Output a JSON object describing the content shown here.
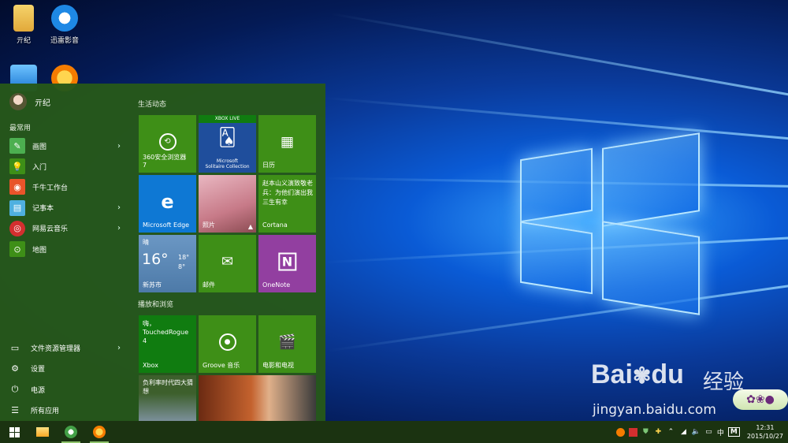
{
  "desktop": {
    "icons": [
      {
        "label": "亓纪",
        "icon": "user-folder-icon"
      },
      {
        "label": "迅雷影音",
        "icon": "xunlei-player-icon"
      },
      {
        "label": "",
        "icon": "this-pc-icon"
      },
      {
        "label": "",
        "icon": "qianniu-icon"
      }
    ]
  },
  "start_menu": {
    "user_name": "亓纪",
    "most_used_label": "最常用",
    "apps": [
      {
        "label": "画图",
        "icon": "paint-icon",
        "has_submenu": true
      },
      {
        "label": "入门",
        "icon": "get-started-icon",
        "has_submenu": false
      },
      {
        "label": "千牛工作台",
        "icon": "qianniu-icon",
        "has_submenu": false
      },
      {
        "label": "记事本",
        "icon": "notepad-icon",
        "has_submenu": true
      },
      {
        "label": "网易云音乐",
        "icon": "netease-music-icon",
        "has_submenu": true
      },
      {
        "label": "地图",
        "icon": "maps-icon",
        "has_submenu": false
      }
    ],
    "system_items": [
      {
        "label": "文件资源管理器",
        "icon": "file-explorer-icon",
        "has_submenu": true
      },
      {
        "label": "设置",
        "icon": "gear-icon"
      },
      {
        "label": "电源",
        "icon": "power-icon"
      },
      {
        "label": "所有应用",
        "icon": "all-apps-icon"
      }
    ],
    "groups": [
      {
        "label": "生活动态"
      },
      {
        "label": "播放和浏览"
      }
    ],
    "tiles": {
      "browser360": {
        "label": "360安全浏览器\n7"
      },
      "solitaire": {
        "badge": "XBOX LIVE",
        "label": "Microsoft\nSolitaire Collection"
      },
      "calendar": {
        "label": "日历"
      },
      "edge": {
        "label": "Microsoft Edge"
      },
      "photos": {
        "label": "照片"
      },
      "cortana": {
        "label": "Cortana",
        "text": "赵本山义演致敬老兵：为他们演出我三生有幸"
      },
      "weather": {
        "condition": "晴",
        "temp": "16°",
        "high": "18°",
        "low": "8°",
        "city": "新苏市"
      },
      "mail": {
        "label": "邮件"
      },
      "onenote": {
        "label": "OneNote"
      },
      "xbox": {
        "label": "Xbox",
        "text": "嗨，\nTouchedRogue\n4"
      },
      "groove": {
        "label": "Groove 音乐"
      },
      "movies": {
        "label": "电影和电视"
      },
      "news": {
        "text": "负利率时代四大猜想"
      },
      "photo2": {
        "label": ""
      }
    }
  },
  "taskbar": {
    "apps": [
      {
        "icon": "windows-start-icon"
      },
      {
        "icon": "file-explorer-icon"
      },
      {
        "icon": "browser-360-icon"
      },
      {
        "icon": "qianniu-icon"
      }
    ],
    "tray": {
      "ime": "中",
      "ime_mode": "M",
      "time": "12:31",
      "date": "2015/10/27"
    }
  },
  "watermark": {
    "brand": "Bai",
    "brand2": "du",
    "cn": "经验",
    "url": "jingyan.baidu.com"
  },
  "colors": {
    "start_bg": "#26581a",
    "tile_green": "#3e8f17",
    "edge_blue": "#0e78d4",
    "weather_blue": "#5b89b8",
    "onenote_purple": "#923fa0",
    "taskbar": "#1b3311"
  }
}
